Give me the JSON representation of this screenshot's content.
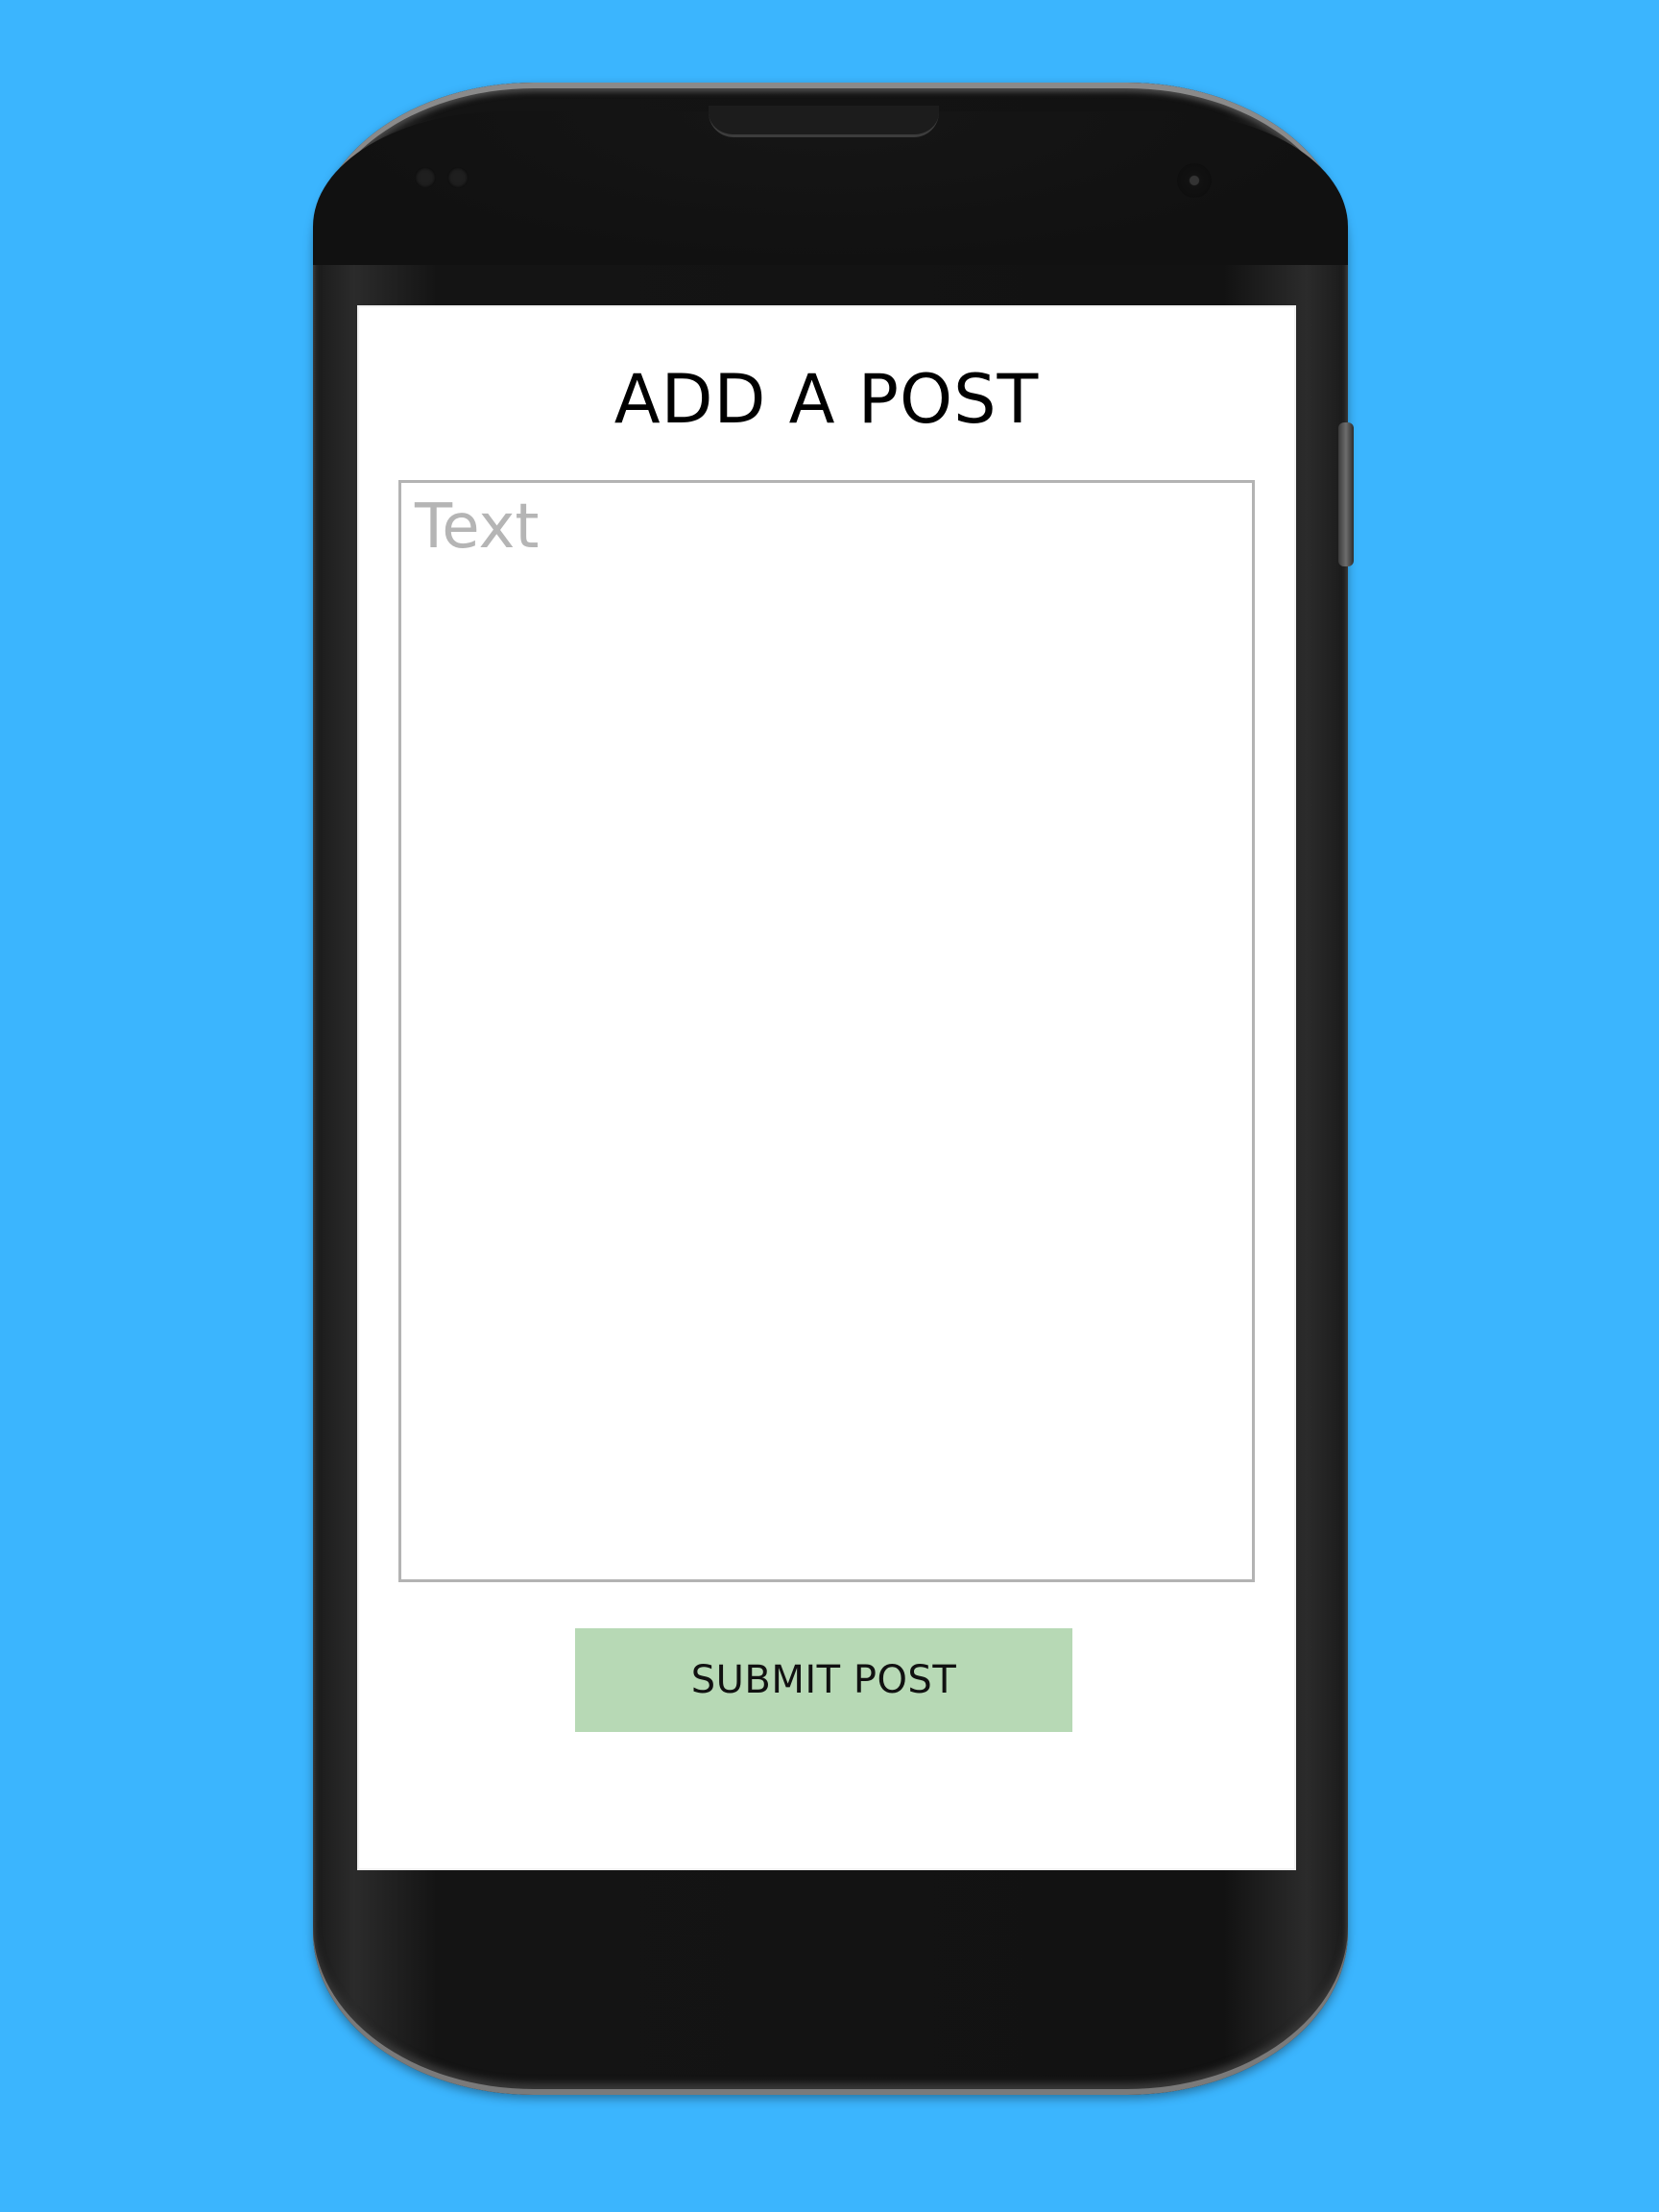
{
  "screen": {
    "title": "ADD A POST",
    "text_area": {
      "placeholder": "Text",
      "value": ""
    },
    "submit_button": {
      "label": "SUBMIT POST"
    }
  },
  "colors": {
    "background": "#3bb5fe",
    "phone_body": "#121212",
    "screen": "#ffffff",
    "text_area_border": "#b3b3b3",
    "placeholder_text": "#b5b5b5",
    "submit_button": "#b7d9b5"
  }
}
